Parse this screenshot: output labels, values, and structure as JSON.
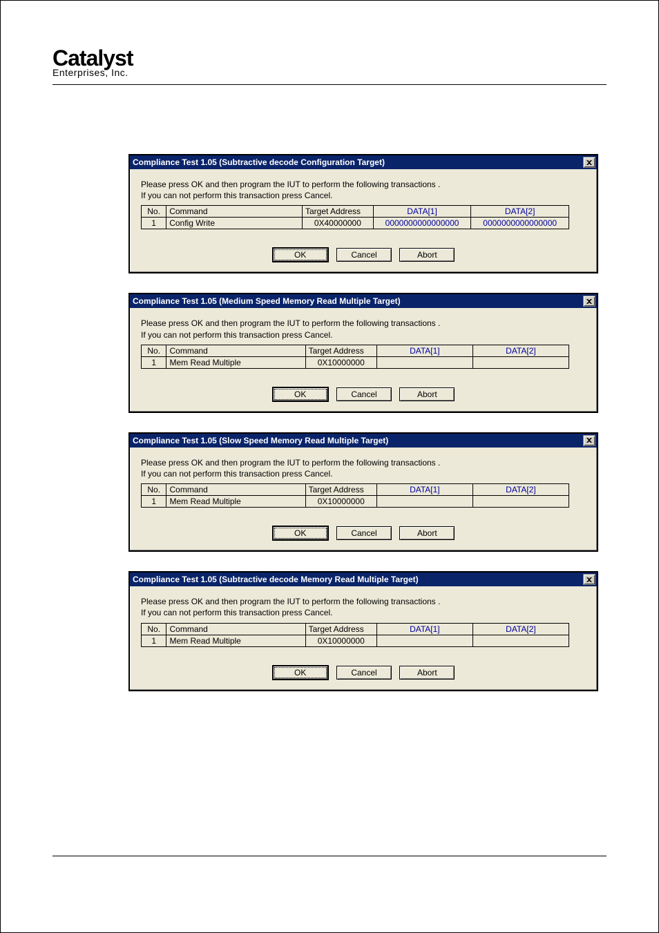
{
  "logo": {
    "main": "Catalyst",
    "sub": "Enterprises, Inc."
  },
  "dialog_common": {
    "instruction_line1": "Please press OK and then program the IUT to perform the following transactions .",
    "instruction_line2": "If you can not perform this transaction press Cancel.",
    "headers": {
      "no": "No.",
      "command": "Command",
      "target": "Target Address",
      "data1": "DATA[1]",
      "data2": "DATA[2]"
    },
    "buttons": {
      "ok": "OK",
      "cancel": "Cancel",
      "abort": "Abort"
    }
  },
  "dialogs": [
    {
      "title": "Compliance Test 1.05 (Subtractive decode Configuration Target)",
      "rows": [
        {
          "no": "1",
          "command": "Config Write",
          "target": "0X40000000",
          "data1": "0000000000000000",
          "data2": "0000000000000000"
        }
      ]
    },
    {
      "title": "Compliance Test 1.05 (Medium Speed Memory Read Multiple Target)",
      "rows": [
        {
          "no": "1",
          "command": "Mem Read Multiple",
          "target": "0X10000000",
          "data1": "",
          "data2": ""
        }
      ]
    },
    {
      "title": "Compliance Test 1.05 (Slow Speed Memory Read Multiple Target)",
      "rows": [
        {
          "no": "1",
          "command": "Mem Read Multiple",
          "target": "0X10000000",
          "data1": "",
          "data2": ""
        }
      ]
    },
    {
      "title": "Compliance Test 1.05 (Subtractive decode Memory Read Multiple Target)",
      "rows": [
        {
          "no": "1",
          "command": "Mem Read Multiple",
          "target": "0X10000000",
          "data1": "",
          "data2": ""
        }
      ]
    }
  ]
}
